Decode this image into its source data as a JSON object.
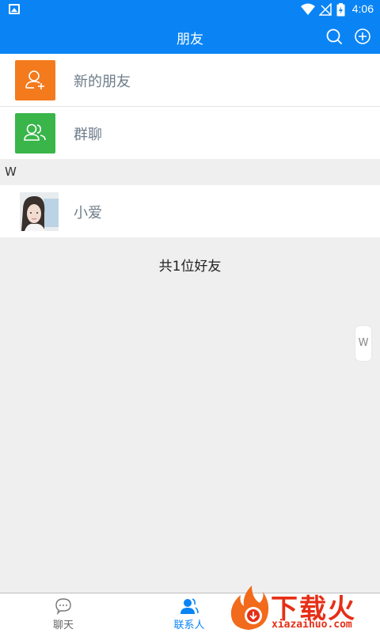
{
  "status_bar": {
    "time": "4:06"
  },
  "header": {
    "title": "朋友",
    "search_icon": "search-icon",
    "add_icon": "plus-circle-icon"
  },
  "list": {
    "new_friends_label": "新的朋友",
    "group_chat_label": "群聊",
    "section_letter": "W",
    "contacts": [
      {
        "name": "小爱"
      }
    ],
    "total_text": "共1位好友"
  },
  "index_bar": {
    "letter": "W"
  },
  "tabs": [
    {
      "label": "聊天",
      "icon": "chat-bubble-icon",
      "active": false
    },
    {
      "label": "联系人",
      "icon": "contacts-icon",
      "active": true
    }
  ],
  "watermark": {
    "text": "下载火",
    "url": "xiazaihuo.com"
  },
  "colors": {
    "primary": "#0a84f5",
    "new_friends_bg": "#f37b1d",
    "group_bg": "#39b54a"
  }
}
